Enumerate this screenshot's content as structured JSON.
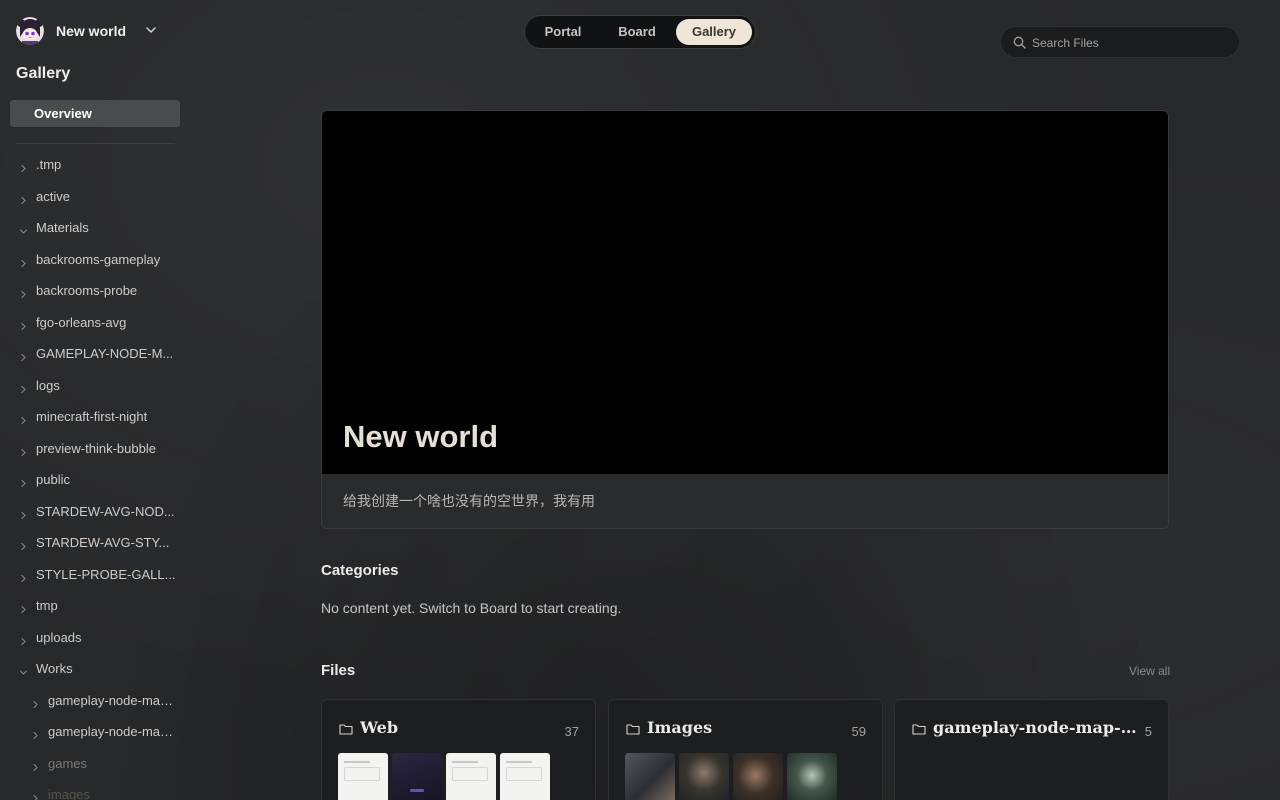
{
  "workspace": {
    "name": "New world"
  },
  "sidebar": {
    "title": "Gallery",
    "overview_label": "Overview",
    "tree": [
      {
        "label": ".tmp",
        "expanded": false
      },
      {
        "label": "active",
        "expanded": false
      },
      {
        "label": "Materials",
        "expanded": true
      },
      {
        "label": "backrooms-gameplay",
        "expanded": false
      },
      {
        "label": "backrooms-probe",
        "expanded": false
      },
      {
        "label": "fgo-orleans-avg",
        "expanded": false
      },
      {
        "label": "GAMEPLAY-NODE-M...",
        "expanded": false
      },
      {
        "label": "logs",
        "expanded": false
      },
      {
        "label": "minecraft-first-night",
        "expanded": false
      },
      {
        "label": "preview-think-bubble",
        "expanded": false
      },
      {
        "label": "public",
        "expanded": false
      },
      {
        "label": "STARDEW-AVG-NOD...",
        "expanded": false
      },
      {
        "label": "STARDEW-AVG-STY...",
        "expanded": false
      },
      {
        "label": "STYLE-PROBE-GALL...",
        "expanded": false
      },
      {
        "label": "tmp",
        "expanded": false
      },
      {
        "label": "uploads",
        "expanded": false
      },
      {
        "label": "Works",
        "expanded": true
      },
      {
        "label": "gameplay-node-map...",
        "expanded": false
      },
      {
        "label": "gameplay-node-map...",
        "expanded": false
      },
      {
        "label": "games",
        "expanded": false
      },
      {
        "label": "images",
        "expanded": false
      }
    ]
  },
  "tabs": [
    {
      "label": "Portal",
      "active": false
    },
    {
      "label": "Board",
      "active": false
    },
    {
      "label": "Gallery",
      "active": true
    }
  ],
  "search": {
    "placeholder": "Search Files",
    "value": ""
  },
  "hero": {
    "title": "New world",
    "description": "给我创建一个啥也没有的空世界，我有用"
  },
  "categories": {
    "title": "Categories",
    "empty_text": "No content yet. Switch to Board to start creating."
  },
  "files": {
    "title": "Files",
    "view_all_label": "View all",
    "cards": [
      {
        "name": "Web",
        "count": "37"
      },
      {
        "name": "Images",
        "count": "59"
      },
      {
        "name": "gameplay-node-map-gen…",
        "count": "5"
      }
    ]
  },
  "colors": {
    "background": "#27282a",
    "active_tab": "#efe6d8",
    "overview_highlight": "#4a4b4e",
    "hero_cover": "#000000",
    "hero_title": "#e6dfd3"
  },
  "icons": {
    "workspace_avatar": "anime-girl-avatar-icon",
    "workspace_switch": "chevron-down-icon",
    "tree_collapsed": "chevron-right-icon",
    "tree_expanded": "chevron-down-icon",
    "search": "search-icon",
    "folder": "folder-icon"
  }
}
